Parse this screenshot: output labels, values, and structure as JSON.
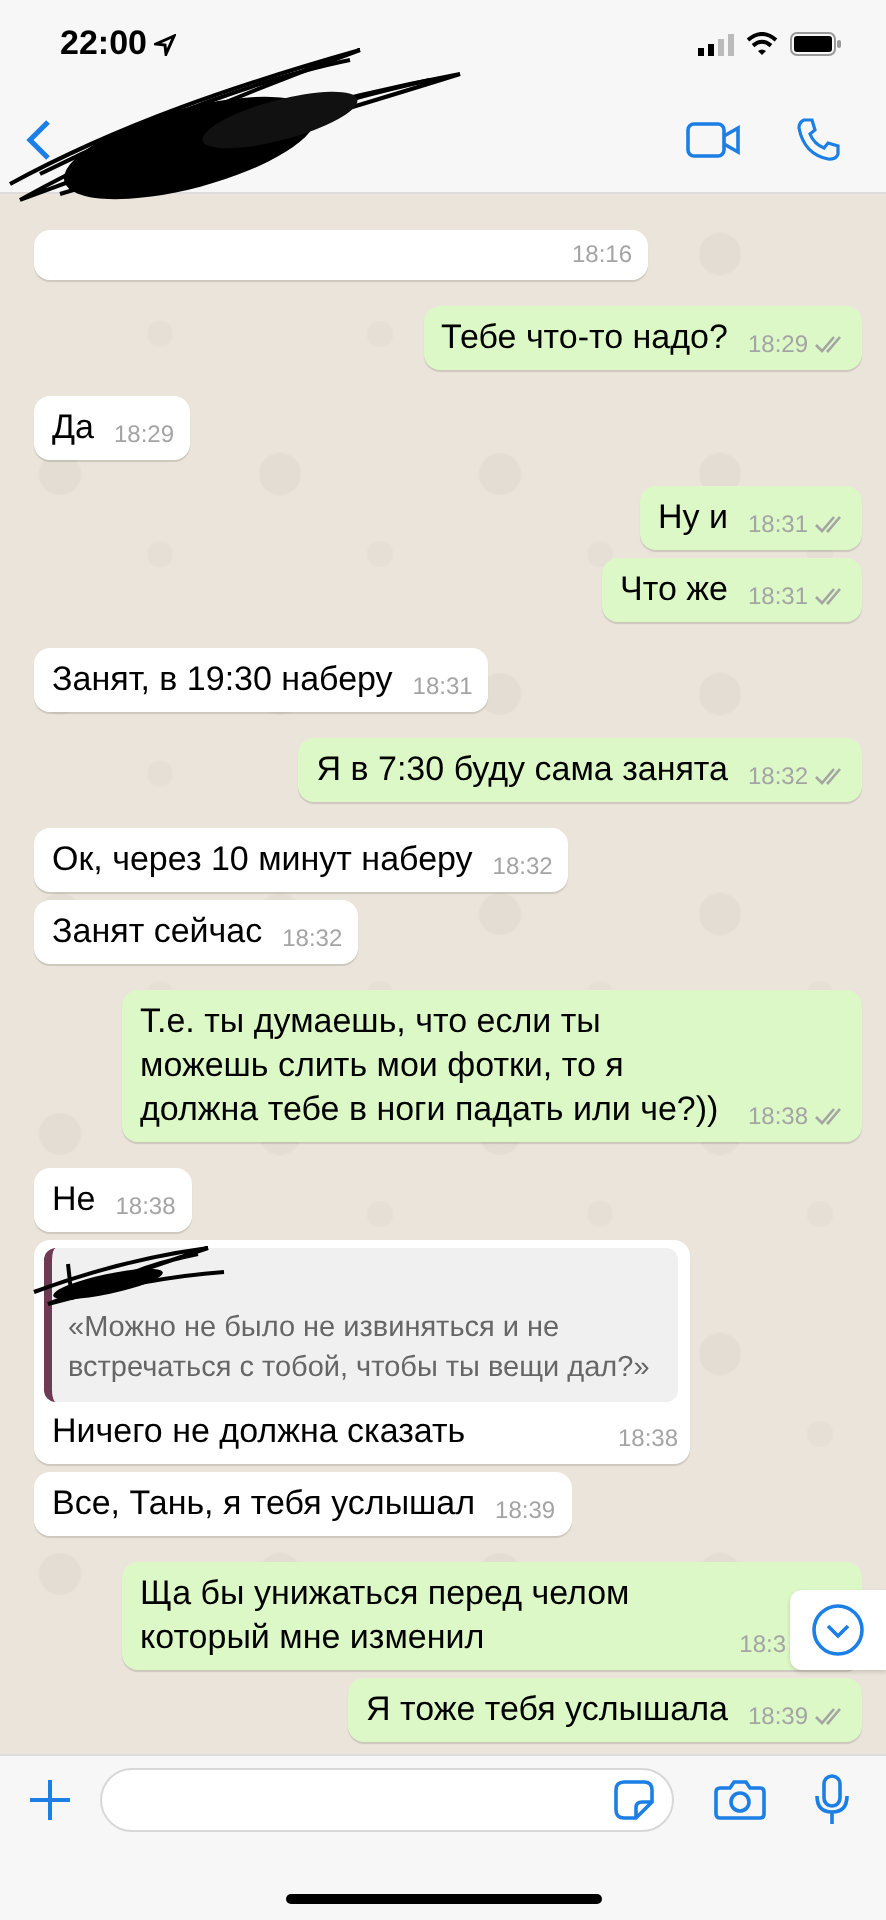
{
  "status_bar": {
    "time": "22:00"
  },
  "messages": [
    {
      "kind": "incoming",
      "time": "18:16"
    },
    {
      "kind": "outgoing",
      "text": "Тебе что-то надо?",
      "time": "18:29",
      "delivered": true
    },
    {
      "kind": "incoming",
      "text": "Да",
      "time": "18:29"
    },
    {
      "kind": "outgoing",
      "text": "Ну и",
      "time": "18:31",
      "delivered": true
    },
    {
      "kind": "outgoing",
      "text": "Что же",
      "time": "18:31",
      "delivered": true
    },
    {
      "kind": "incoming",
      "text": "Занят, в 19:30 наберу",
      "time": "18:31"
    },
    {
      "kind": "outgoing",
      "text": "Я в 7:30 буду сама занята",
      "time": "18:32",
      "delivered": true
    },
    {
      "kind": "incoming",
      "text": "Ок, через 10 минут наберу",
      "time": "18:32"
    },
    {
      "kind": "incoming",
      "text": "Занят сейчас",
      "time": "18:32"
    },
    {
      "kind": "outgoing",
      "text": "Т.е. ты думаешь, что если ты можешь слить мои фотки, то я должна тебе в ноги падать или че?))",
      "time": "18:38",
      "delivered": true
    },
    {
      "kind": "incoming",
      "text": "Не",
      "time": "18:38"
    },
    {
      "kind": "reply",
      "quote": "«Можно не было не извиняться и не встречаться с тобой, чтобы ты вещи дал?»",
      "text": "Ничего не должна сказать",
      "time": "18:38"
    },
    {
      "kind": "incoming",
      "text": "Все, Тань, я тебя услышал",
      "time": "18:39"
    },
    {
      "kind": "outgoing",
      "text": "Ща бы унижаться перед челом который мне изменил",
      "time": "18:3",
      "scroll_button": true
    },
    {
      "kind": "outgoing",
      "text": "Я тоже тебя услышала",
      "time": "18:39",
      "delivered": true
    }
  ]
}
